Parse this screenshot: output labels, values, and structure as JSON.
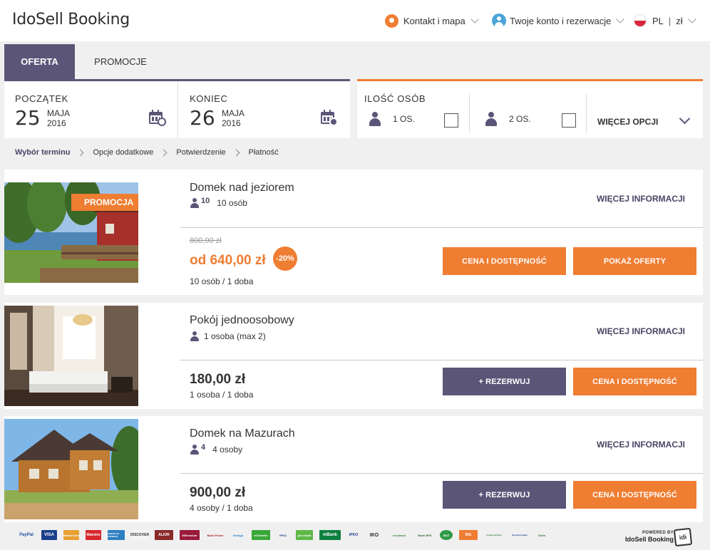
{
  "header": {
    "logo": "IdoSell Booking",
    "contact": "Kontakt i mapa",
    "account": "Twoje konto i rezerwacje",
    "lang": "PL",
    "separator": "|",
    "currency": "zł"
  },
  "tabs": {
    "offer": "OFERTA",
    "promotions": "PROMOCJE"
  },
  "dates": {
    "start": {
      "label": "POCZĄTEK",
      "day": "25",
      "month": "MAJA",
      "year": "2016"
    },
    "end": {
      "label": "KONIEC",
      "day": "26",
      "month": "MAJA",
      "year": "2016"
    }
  },
  "persons": {
    "label": "ILOŚĆ OSÓB",
    "opt1": "1 OS.",
    "opt2": "2 OS.",
    "more": "WIĘCEJ OPCJI"
  },
  "breadcrumb": [
    "Wybór terminu",
    "Opcje dodatkowe",
    "Potwierdzenie",
    "Płatność"
  ],
  "offers": [
    {
      "badge": "PROMOCJA",
      "name": "Domek nad jeziorem",
      "cap_num": "10",
      "capacity": "10 osób",
      "more_info": "WIĘCEJ INFORMACJI",
      "old_price": "800,00 zł",
      "price": "od 640,00 zł",
      "discount": "-20%",
      "per": "10 osób / 1 doba",
      "btn1": "CENA I DOSTĘPNOŚĆ",
      "btn2": "POKAŻ OFERTY"
    },
    {
      "name": "Pokój jednoosobowy",
      "capacity": "1 osoba (max 2)",
      "more_info": "WIĘCEJ INFORMACJI",
      "price": "180,00 zł",
      "per": "1 osoba / 1 doba",
      "btn1": "+ REZERWUJ",
      "btn2": "CENA I DOSTĘPNOŚĆ"
    },
    {
      "name": "Domek na Mazurach",
      "cap_num": "4",
      "capacity": "4 osoby",
      "more_info": "WIĘCEJ INFORMACJI",
      "price": "900,00 zł",
      "per": "4 osoby / 1 doba",
      "btn1": "+ REZERWUJ",
      "btn2": "CENA I DOSTĘPNOŚĆ"
    }
  ],
  "footer": {
    "payments": [
      "PayPal",
      "VISA",
      "MasterCard",
      "Maestro",
      "AMERICAN EXPRESS",
      "DISCOVER",
      "ALIOR",
      "Millennium",
      "Bank Pekao",
      "Inteligo",
      "mTransfer",
      "iPKO",
      "plus bank",
      "mBank",
      "IPKO",
      "IKO",
      "eurobank",
      "Bank BPS",
      "BGŻ",
      "ING",
      "Credit Agricole",
      "Deutsche Bank",
      "Getin"
    ],
    "powered_by": "POWERED BY",
    "brand": "IdoSell Booking",
    "badge": "idi"
  },
  "colors": {
    "accent": "#ef7d32",
    "primary": "#5b5678"
  }
}
